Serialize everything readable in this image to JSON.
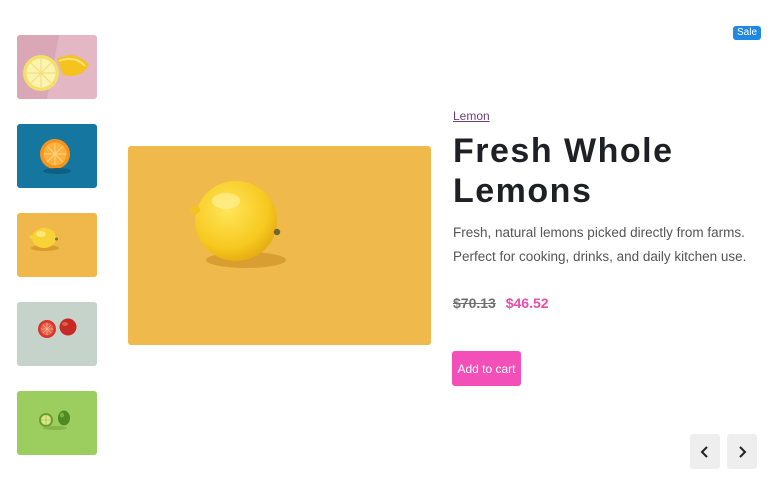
{
  "badge": {
    "label": "Sale"
  },
  "product": {
    "category": "Lemon",
    "title": "Fresh Whole Lemons",
    "description": "Fresh, natural lemons picked directly from farms. Perfect for cooking, drinks, and daily kitchen use.",
    "old_price": "$70.13",
    "new_price": "$46.52",
    "add_to_cart_label": "Add to cart"
  },
  "thumbnails": [
    {
      "subject": "halved-lemon-on-pink",
      "background": "#e3b8c4"
    },
    {
      "subject": "halved-orange-on-blue",
      "background": "#1577a0"
    },
    {
      "subject": "whole-lemon-on-yellow",
      "background": "#f0b84a"
    },
    {
      "subject": "blood-oranges-on-sage",
      "background": "#c6d3cb"
    },
    {
      "subject": "limes-on-green",
      "background": "#9ccd5f"
    }
  ],
  "main_image": {
    "subject": "whole-lemon-on-yellow",
    "background": "#efb94c"
  },
  "colors": {
    "accent_pink": "#f24fb8",
    "sale_price": "#ec4ba8",
    "badge_blue": "#1e88e5"
  },
  "navigation": {
    "prev_icon": "chevron-left-icon",
    "next_icon": "chevron-right-icon"
  }
}
